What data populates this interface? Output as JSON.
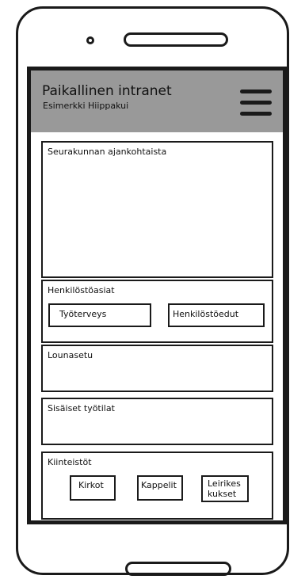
{
  "header": {
    "title": "Paikallinen intranet",
    "subtitle": "Esimerkki Hiippakui",
    "menu_icon": "hamburger-menu-icon",
    "background": "#999999"
  },
  "sections": {
    "news": {
      "title": "Seurakunnan ajankohtaista"
    },
    "staff": {
      "title": "Henkilöstöasiat",
      "buttons": [
        "Työterveys",
        "Henkilöstöedut"
      ]
    },
    "lunch": {
      "title": "Lounasetu"
    },
    "workspaces": {
      "title": "Sisäiset työtilat"
    },
    "properties": {
      "title": "Kiinteistöt",
      "buttons": [
        "Kirkot",
        "Kappelit",
        "Leirikes kukset"
      ]
    }
  }
}
